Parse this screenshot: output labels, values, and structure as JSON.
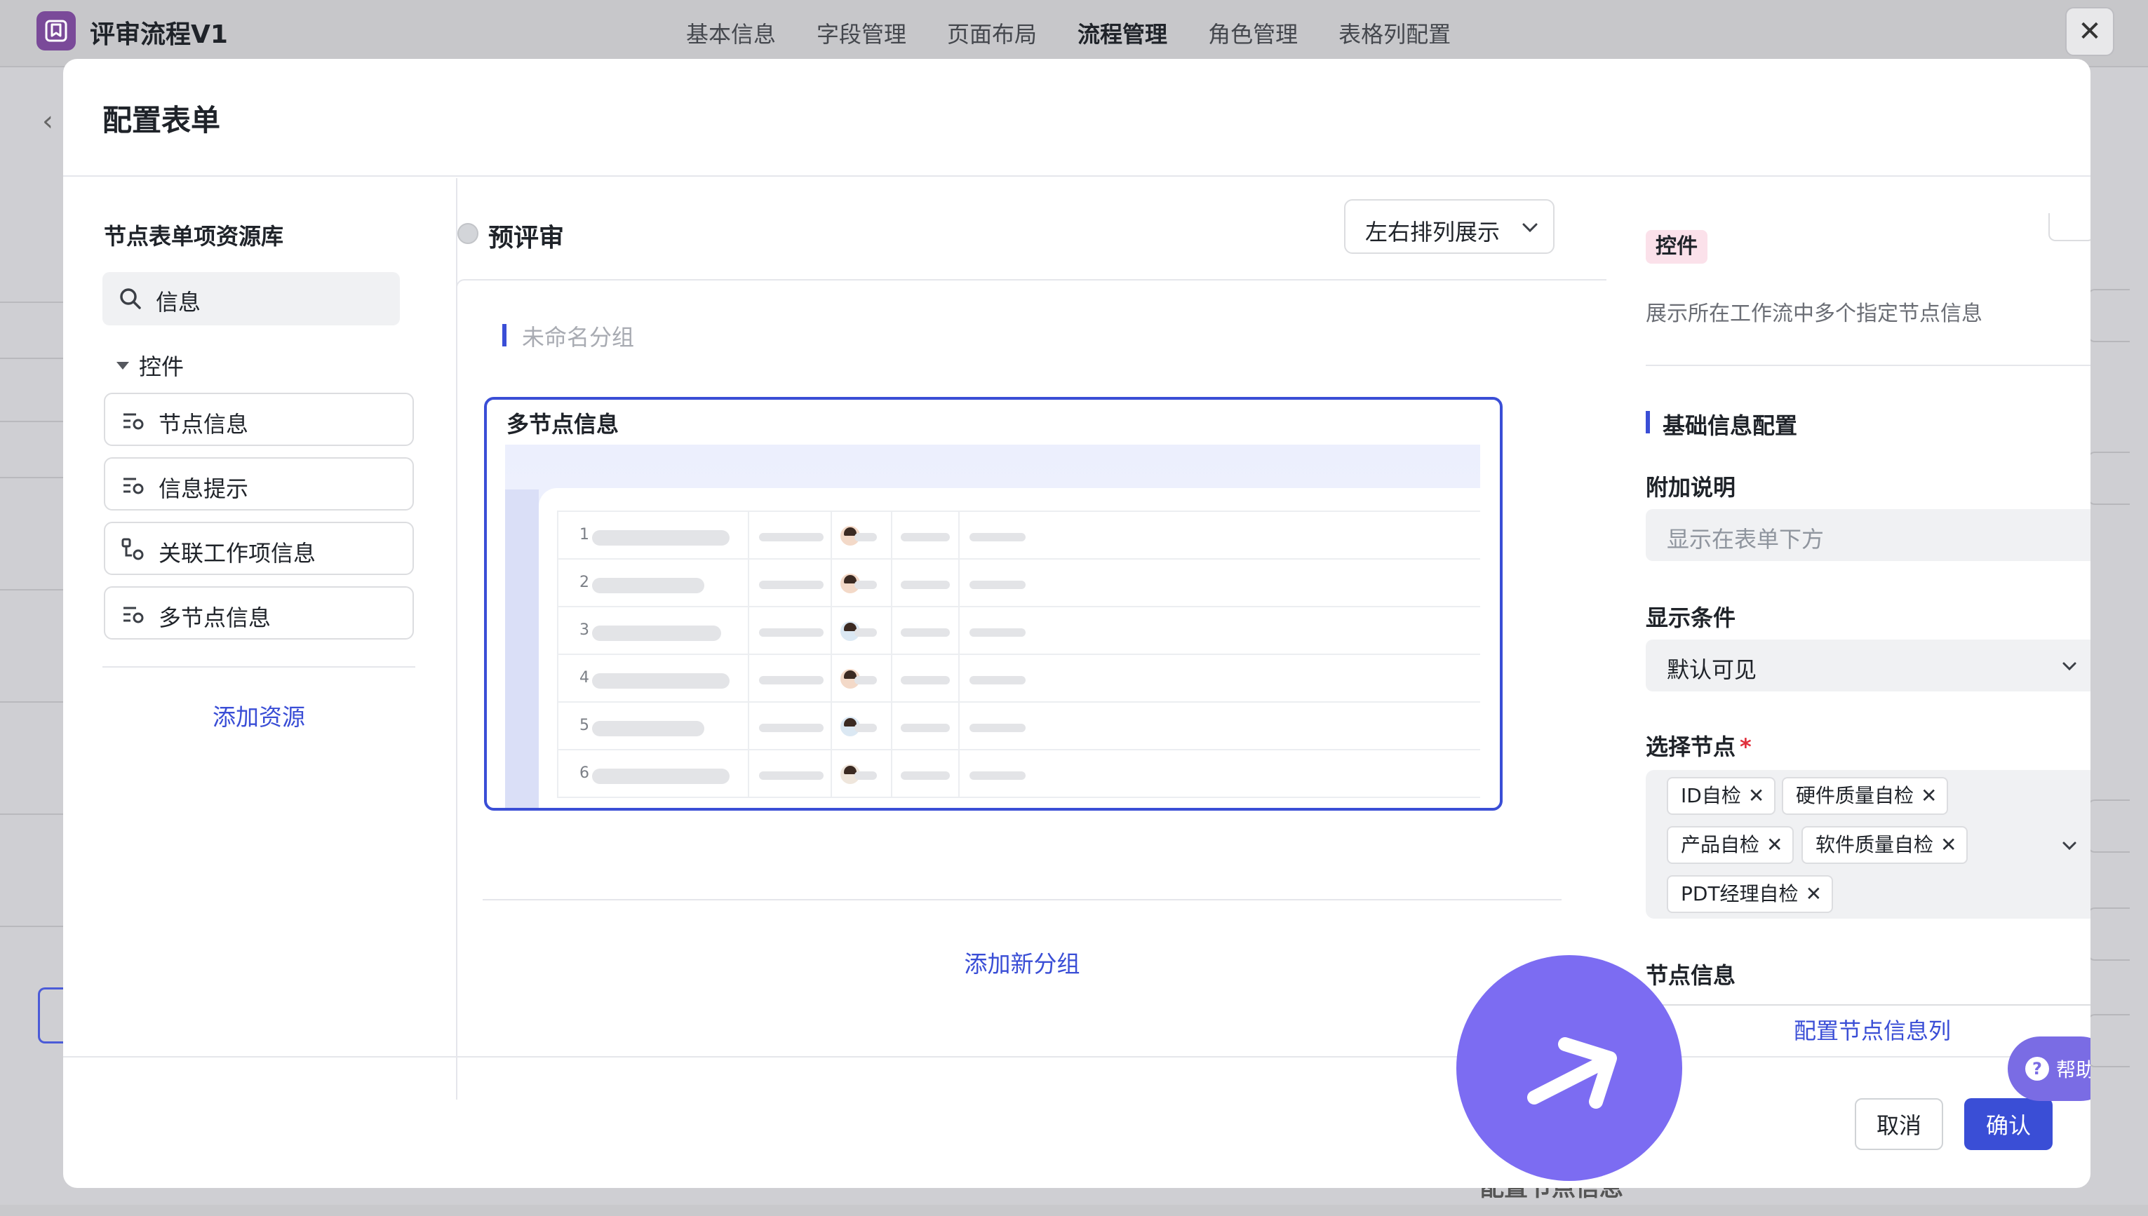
{
  "app": {
    "title": "评审流程V1",
    "nav_tabs": [
      "基本信息",
      "字段管理",
      "页面布局",
      "流程管理",
      "角色管理",
      "表格列配置"
    ],
    "active_tab": "流程管理",
    "close_icon": "close-icon",
    "bg_bottom_text": "配置节点信息"
  },
  "modal": {
    "title": "配置表单",
    "cancel_label": "取消",
    "confirm_label": "确认"
  },
  "library": {
    "title": "节点表单项资源库",
    "search_value": "信息",
    "category": "控件",
    "items": [
      {
        "label": "节点信息",
        "icon": "list-settings-icon"
      },
      {
        "label": "信息提示",
        "icon": "list-settings-icon"
      },
      {
        "label": "关联工作项信息",
        "icon": "link-settings-icon"
      },
      {
        "label": "多节点信息",
        "icon": "list-settings-icon"
      }
    ],
    "add_resource": "添加资源"
  },
  "form": {
    "node_name": "预评审",
    "layout_mode": "左右排列展示",
    "group_name": "未命名分组",
    "card_title": "多节点信息",
    "preview_rows": [
      "1",
      "2",
      "3",
      "4",
      "5",
      "6"
    ],
    "add_group": "添加新分组"
  },
  "properties": {
    "type_tag": "控件",
    "description": "展示所在工作流中多个指定节点信息",
    "section_title": "基础信息配置",
    "extra_note_label": "附加说明",
    "extra_note_placeholder": "显示在表单下方",
    "condition_label": "显示条件",
    "condition_value": "默认可见",
    "nodes_label": "选择节点",
    "required_mark": "*",
    "selected_nodes": [
      "ID自检",
      "硬件质量自检",
      "产品自检",
      "软件质量自检",
      "PDT经理自检"
    ],
    "node_info_label": "节点信息",
    "node_info_button": "配置节点信息列"
  },
  "help": {
    "label": "帮助",
    "icon": "question-icon"
  },
  "colors": {
    "accent": "#3a4ed6",
    "fab": "#7c6cf2",
    "tag_bg": "#fbe1ea"
  }
}
